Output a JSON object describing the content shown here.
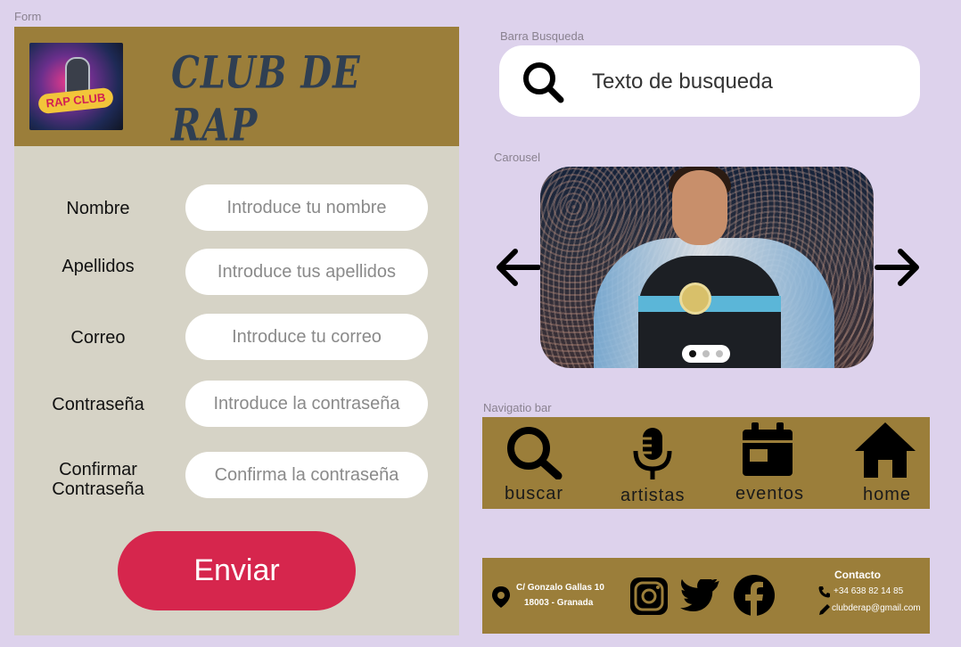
{
  "frame_labels": {
    "form": "Form",
    "search": "Barra Busqueda",
    "carousel": "Carousel",
    "nav": "Navigatio bar"
  },
  "form": {
    "logo_text": "RAP CLUB",
    "title": "CLUB DE RAP",
    "fields": [
      {
        "label": "Nombre",
        "placeholder": "Introduce tu nombre"
      },
      {
        "label": "Apellidos",
        "placeholder": "Introduce tus apellidos"
      },
      {
        "label": "Correo",
        "placeholder": "Introduce tu correo"
      },
      {
        "label": "Contraseña",
        "placeholder": "Introduce la contraseña"
      },
      {
        "label_line1": "Confirmar",
        "label_line2": "Contraseña",
        "placeholder": "Confirma la contraseña"
      }
    ],
    "submit_label": "Enviar"
  },
  "search": {
    "icon": "search-icon",
    "placeholder": "Texto de busqueda"
  },
  "carousel": {
    "slide_count": 3,
    "active_slide": 1,
    "prev_icon": "arrow-left-icon",
    "next_icon": "arrow-right-icon"
  },
  "nav": {
    "items": [
      {
        "label": "buscar",
        "icon": "search-icon"
      },
      {
        "label": "artistas",
        "icon": "microphone-icon"
      },
      {
        "label": "eventos",
        "icon": "calendar-icon"
      },
      {
        "label": "home",
        "icon": "home-icon"
      }
    ]
  },
  "footer": {
    "address_line1": "C/ Gonzalo Gallas 10",
    "address_line2": "18003 - Granada",
    "social": [
      "instagram-icon",
      "twitter-icon",
      "facebook-icon"
    ],
    "contact_title": "Contacto",
    "phone": "+34 638 82 14 85",
    "email": "clubderap@gmail.com"
  },
  "colors": {
    "background": "#ddd2ec",
    "gold": "#9b7e3a",
    "form_bg": "#d6d3c6",
    "submit": "#d6264d",
    "title": "#2f3f52"
  }
}
